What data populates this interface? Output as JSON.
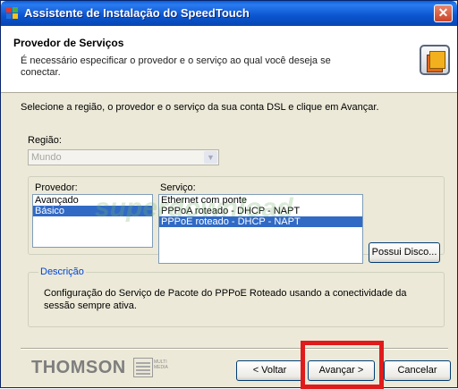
{
  "window": {
    "title": "Assistente de Instalação do SpeedTouch",
    "close_glyph": "✕"
  },
  "header": {
    "title": "Provedor de Serviços",
    "description": "É necessário especificar o provedor e o serviço ao qual você deseja se conectar."
  },
  "instruction": "Selecione a região, o provedor e o serviço da sua conta DSL e clique em Avançar.",
  "region": {
    "label": "Região:",
    "value": "Mundo"
  },
  "provider": {
    "label": "Provedor:",
    "items": [
      "Avançado",
      "Básico"
    ],
    "selected_index": 1
  },
  "service": {
    "label": "Serviço:",
    "items": [
      "Ethernet com ponte",
      "PPPoA roteado - DHCP - NAPT",
      "PPPoE roteado - DHCP - NAPT"
    ],
    "selected_index": 2
  },
  "have_disk_button": "Possui Disco...",
  "description": {
    "legend": "Descrição",
    "text": "Configuração do Serviço de Pacote do PPPoE Roteado usando a conectividade da sessão sempre ativa."
  },
  "footer": {
    "brand": "THOMSON",
    "brand_sub": "MULTI MEDIA",
    "back_button": "< Voltar",
    "next_button": "Avançar >",
    "cancel_button": "Cancelar"
  },
  "watermark": "superdownload",
  "colors": {
    "selection": "#316ac5",
    "highlight": "#e01b1b",
    "titlebar": "#0b55cf"
  }
}
